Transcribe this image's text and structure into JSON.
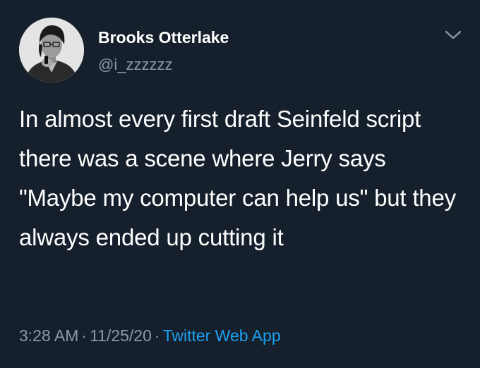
{
  "author": {
    "name": "Brooks Otterlake",
    "handle": "@i_zzzzzz"
  },
  "tweet": {
    "text": "In almost every first draft Seinfeld script there was a scene where Jerry says \"Maybe my computer can help us\" but they always ended up cutting it",
    "time": "3:28 AM",
    "date": "11/25/20",
    "separator": "·",
    "source": "Twitter Web App"
  },
  "icons": {
    "caret": "chevron-down-icon",
    "avatar": "avatar-photo"
  },
  "colors": {
    "background": "#16202c",
    "primary_text": "#ffffff",
    "secondary_text": "#8899a6",
    "link": "#1da1f2"
  }
}
